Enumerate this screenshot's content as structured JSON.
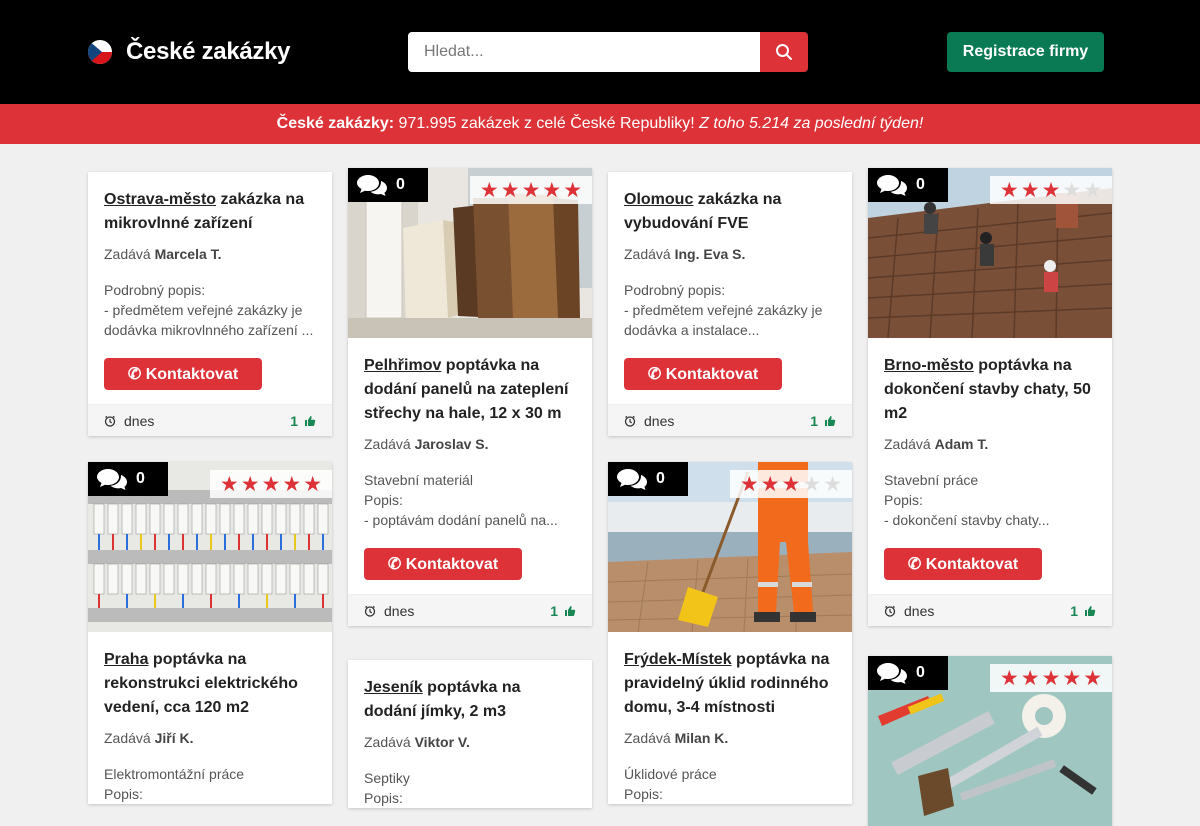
{
  "header": {
    "logo_text": "České zakázky",
    "search_placeholder": "Hledat...",
    "register_label": "Registrace firmy"
  },
  "banner": {
    "prefix": "České zakázky:",
    "text": " 971.995 zakázek z celé České Republiky! ",
    "italic": "Z toho 5.214 za poslední týden!"
  },
  "colors": {
    "accent": "#dc3238",
    "green": "#0a7a55",
    "header_bg": "#000000"
  },
  "common": {
    "zadava": "Zadává",
    "contact": "✆ Kontaktovat",
    "date": "dnes",
    "popis": "Popis:",
    "podrobny": "Podrobný popis:"
  },
  "cards": [
    {
      "city": "Ostrava-město",
      "title": " zakázka na mikrovlnné zařízení",
      "author": "Marcela T.",
      "category": "Podrobný popis:",
      "desc": [
        "- předmětem veřejné zakázky je",
        "dodávka mikrovlnného zařízení ..."
      ],
      "likes": "1"
    },
    {
      "comments": "0",
      "rating": 5,
      "image": "windows-profiles",
      "city": "Pelhřimov",
      "title": " poptávka na dodání panelů na zateplení střechy na hale, 12 x 30 m",
      "author": "Jaroslav S.",
      "category": "Stavební materiál",
      "popis": "Popis:",
      "desc": [
        "- poptávám dodání panelů na..."
      ],
      "likes": "1"
    },
    {
      "city": "Olomouc",
      "title": " zakázka na vybudování FVE",
      "author": "Ing. Eva S.",
      "category": "Podrobný popis:",
      "desc": [
        "- předmětem veřejné zakázky je",
        "dodávka a instalace..."
      ],
      "likes": "1"
    },
    {
      "comments": "0",
      "rating": 3,
      "image": "roof-workers",
      "city": "Brno-město",
      "title": " poptávka na dokončení stavby chaty, 50 m2",
      "author": "Adam T.",
      "category": "Stavební práce",
      "popis": "Popis:",
      "desc": [
        "- dokončení stavby chaty..."
      ],
      "likes": "1"
    },
    {
      "comments": "0",
      "rating": 5,
      "image": "electrical-panel",
      "city": "Praha",
      "title": " poptávka na rekonstrukci elektrického vedení, cca 120 m2",
      "author": "Jiří K.",
      "category": "Elektromontážní práce",
      "popis": "Popis:"
    },
    {
      "city": "Jeseník",
      "title": " poptávka na dodání jímky, 2 m3",
      "author": "Viktor V.",
      "category": "Septiky",
      "popis": "Popis:"
    },
    {
      "comments": "0",
      "rating": 3,
      "image": "street-sweeper",
      "city": "Frýdek-Místek",
      "title": " poptávka na pravidelný úklid rodinného domu, 3-4 místnosti",
      "author": "Milan K.",
      "category": "Úklidové práce",
      "popis": "Popis:"
    },
    {
      "comments": "0",
      "rating": 5,
      "image": "tools"
    }
  ]
}
